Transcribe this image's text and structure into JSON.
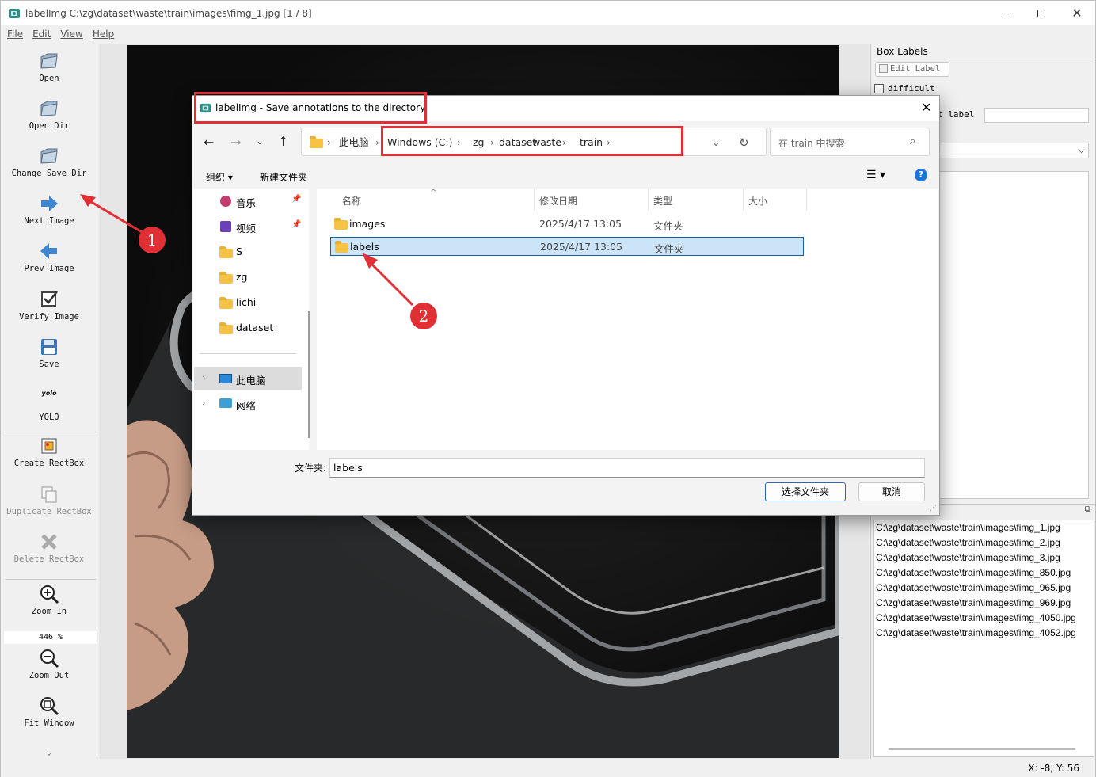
{
  "app": {
    "title": "labelImg C:\\zg\\dataset\\waste\\train\\images\\fimg_1.jpg [1 / 8]"
  },
  "menu": [
    "File",
    "Edit",
    "View",
    "Help"
  ],
  "toolbar": {
    "open": "Open",
    "open_dir": "Open Dir",
    "change_save_dir": "Change Save Dir",
    "next_image": "Next Image",
    "prev_image": "Prev Image",
    "verify_image": "Verify Image",
    "save": "Save",
    "format_icon_text": "yolo",
    "format": "YOLO",
    "create_rectbox": "Create RectBox",
    "duplicate_rectbox": "Duplicate RectBox",
    "delete_rectbox": "Delete RectBox",
    "zoom_in": "Zoom In",
    "zoom_value": "446 %",
    "zoom_out": "Zoom Out",
    "fit_window": "Fit Window"
  },
  "right_panel": {
    "box_labels_title": "Box Labels",
    "edit_label": "Edit Label",
    "difficult": "difficult",
    "use_default_label": "t label",
    "file_list": [
      "C:\\zg\\dataset\\waste\\train\\images\\fimg_1.jpg",
      "C:\\zg\\dataset\\waste\\train\\images\\fimg_2.jpg",
      "C:\\zg\\dataset\\waste\\train\\images\\fimg_3.jpg",
      "C:\\zg\\dataset\\waste\\train\\images\\fimg_850.jpg",
      "C:\\zg\\dataset\\waste\\train\\images\\fimg_965.jpg",
      "C:\\zg\\dataset\\waste\\train\\images\\fimg_969.jpg",
      "C:\\zg\\dataset\\waste\\train\\images\\fimg_4050.jpg",
      "C:\\zg\\dataset\\waste\\train\\images\\fimg_4052.jpg"
    ]
  },
  "status": {
    "coords": "X: -8; Y: 56"
  },
  "dialog": {
    "title": "labelImg - Save annotations to the directory",
    "breadcrumb_root": "此电脑",
    "breadcrumb": [
      "Windows (C:)",
      "zg",
      "dataset",
      "waste",
      "train"
    ],
    "search_placeholder": "在 train 中搜索",
    "organize": "组织",
    "new_folder": "新建文件夹",
    "sidebar": [
      "音乐",
      "视频",
      "S",
      "zg",
      "lichi",
      "dataset"
    ],
    "this_pc": "此电脑",
    "network": "网络",
    "columns": {
      "name": "名称",
      "modified": "修改日期",
      "type": "类型",
      "size": "大小"
    },
    "files": [
      {
        "name": "images",
        "modified": "2025/4/17 13:05",
        "type": "文件夹"
      },
      {
        "name": "labels",
        "modified": "2025/4/17 13:05",
        "type": "文件夹"
      }
    ],
    "folder_label": "文件夹:",
    "folder_value": "labels",
    "select_button": "选择文件夹",
    "cancel_button": "取消"
  },
  "annotations": {
    "marker1": "1",
    "marker2": "2",
    "color": "#e03035"
  }
}
